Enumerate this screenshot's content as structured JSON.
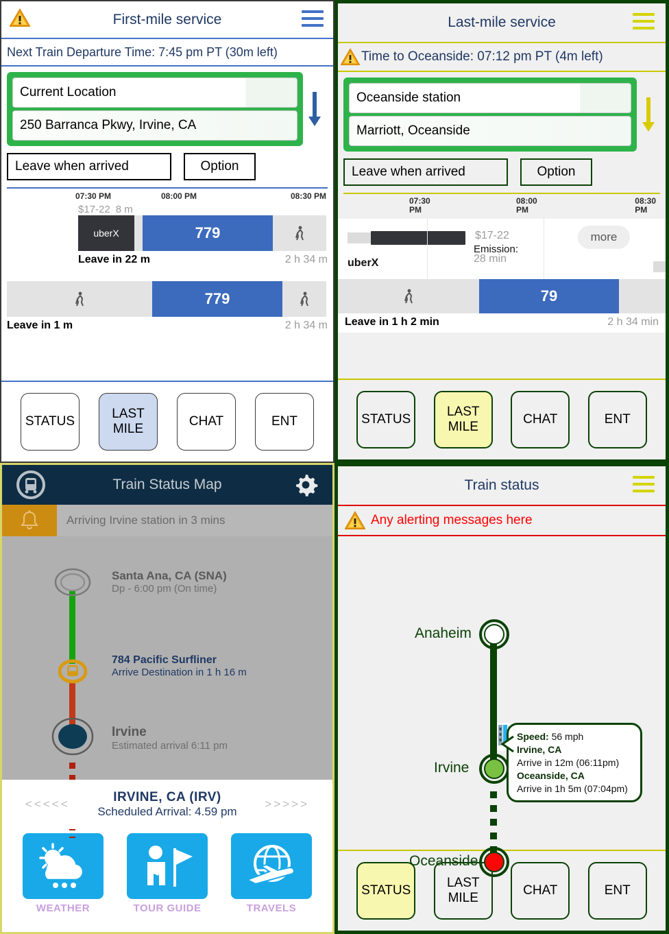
{
  "panel1": {
    "title": "First-mile service",
    "warning_icon": "warning-triangle-icon",
    "menu_icon": "hamburger-menu-icon",
    "status_line": "Next Train Departure Time: 7:45 pm PT (30m left)",
    "origin_value": "Current Location",
    "destination_value": "250 Barranca Pkwy, Irvine, CA",
    "swap_icon": "arrow-down-icon",
    "leave_button": "Leave when arrived",
    "option_button": "Option",
    "timeline": {
      "ticks": [
        "07:30 PM",
        "08:00 PM",
        "08:30 PM"
      ],
      "routes": [
        {
          "price_label": "$17-22",
          "duration_label": "8 m",
          "segments": [
            {
              "kind": "uberx",
              "label": "uberX"
            },
            {
              "kind": "gap",
              "label": ""
            },
            {
              "kind": "bus",
              "label": "779"
            },
            {
              "kind": "walk",
              "label": "walk-icon"
            }
          ],
          "leave": "Leave in 22 m",
          "total": "2 h 34 m"
        },
        {
          "price_label": "",
          "duration_label": "",
          "segments": [
            {
              "kind": "walk",
              "label": "walk-icon"
            },
            {
              "kind": "bus",
              "label": "779"
            },
            {
              "kind": "walk",
              "label": "walk-icon"
            }
          ],
          "leave": "Leave in 1 m",
          "total": "2 h 34 m"
        }
      ]
    },
    "nav": [
      {
        "label": "STATUS",
        "selected": false
      },
      {
        "label": "LAST\nMILE",
        "selected": true
      },
      {
        "label": "CHAT",
        "selected": false
      },
      {
        "label": "ENT",
        "selected": false
      }
    ]
  },
  "panel2": {
    "title": "Last-mile service",
    "warning_icon": "warning-triangle-icon",
    "menu_icon": "hamburger-menu-icon",
    "status_line": "Time to Oceanside: 07:12 pm PT (4m left)",
    "origin_value": "Oceanside station",
    "destination_value": "Marriott, Oceanside",
    "swap_icon": "arrow-down-icon",
    "leave_button": "Leave when arrived",
    "option_button": "Option",
    "timeline": {
      "ticks": [
        "07:30\nPM",
        "08:00\nPM",
        "08:30\nPM"
      ],
      "uberx_label": "uberX",
      "price_label": "$17-22",
      "emission_label": "Emission:",
      "duration_label": "28 min",
      "more_label": "more",
      "bus_label": "79",
      "walk_icon": "walk-icon",
      "leave": "Leave in 1 h 2 min",
      "total": "2 h 34 min"
    },
    "nav": [
      {
        "label": "STATUS",
        "selected": false
      },
      {
        "label": "LAST\nMILE",
        "selected": true
      },
      {
        "label": "CHAT",
        "selected": false
      },
      {
        "label": "ENT",
        "selected": false
      }
    ]
  },
  "panel3": {
    "title": "Train Status Map",
    "train_icon": "train-logo-icon",
    "settings_icon": "gear-icon",
    "alert_icon": "bell-icon",
    "alert_text": "Arriving Irvine station in 3 mins",
    "stops": [
      {
        "name": "Santa Ana, CA (SNA)",
        "sub": "Dp - 6:00 pm  (On time)"
      },
      {
        "name": "Irvine",
        "sub": "Estimated arrival 6:11 pm"
      }
    ],
    "route": {
      "name": "784 Pacific Surfliner",
      "sub": "Arrive Destination in 1 h 16 m"
    },
    "footer": {
      "left_chevrons": "<<<<<",
      "right_chevrons": ">>>>>",
      "station": "IRVINE, CA (IRV)",
      "scheduled": "Scheduled Arrival: 4.59 pm"
    },
    "apps": [
      {
        "label": "WEATHER",
        "icon": "weather-cloud-sun-rain-icon"
      },
      {
        "label": "TOUR GUIDE",
        "icon": "tour-guide-flag-icon"
      },
      {
        "label": "TRAVELS",
        "icon": "globe-airplane-icon"
      }
    ]
  },
  "panel4": {
    "title": "Train status",
    "menu_icon": "hamburger-menu-icon",
    "alert_icon": "warning-triangle-icon",
    "alert_text": "Any alerting messages here",
    "stations": [
      {
        "name": "Anaheim",
        "state": "passed"
      },
      {
        "name": "Irvine",
        "state": "next"
      },
      {
        "name": "Oceanside",
        "state": "destination"
      }
    ],
    "train_icon": "train-marker-icon",
    "callout": {
      "speed_label": "Speed:",
      "speed_value": "56 mph",
      "stop1_name": "Irvine, CA",
      "stop1_eta": "Arrive in 12m (06:11pm)",
      "stop2_name": "Oceanside, CA",
      "stop2_eta": "Arrive in 1h 5m (07:04pm)"
    },
    "nav": [
      {
        "label": "STATUS",
        "selected": true
      },
      {
        "label": "LAST\nMILE",
        "selected": false
      },
      {
        "label": "CHAT",
        "selected": false
      },
      {
        "label": "ENT",
        "selected": false
      }
    ]
  },
  "colors": {
    "blue_accent": "#4472c4",
    "dark_blue_text": "#1f3864",
    "green_border": "#0b4206",
    "green_input": "#2eb34a",
    "yellow_line": "#c8c800",
    "red_alert": "#ff0000",
    "bus_blue": "#3c6bbd",
    "uber_black": "#33333a",
    "app_blue": "#19a9e8"
  }
}
